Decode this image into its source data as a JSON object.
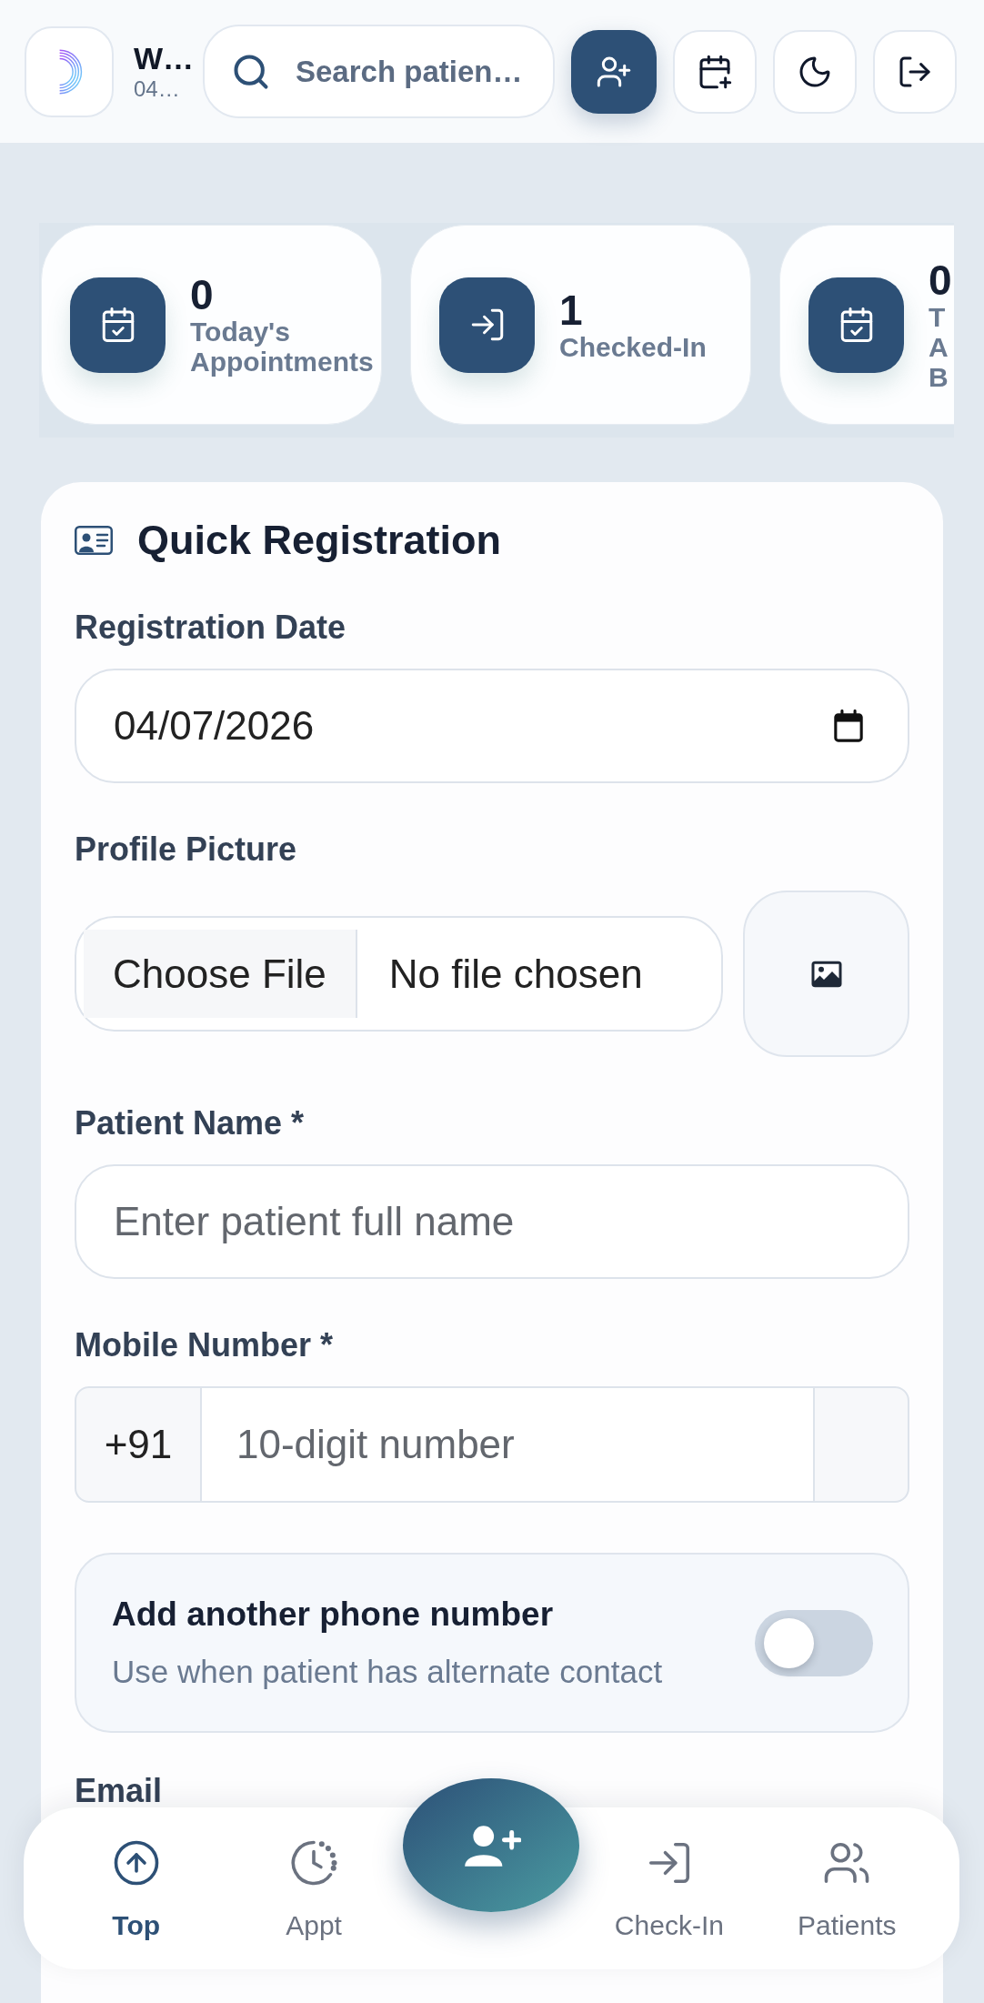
{
  "header": {
    "title": "W…",
    "subtitle": "04…",
    "search": {
      "placeholder": "Search patien…"
    }
  },
  "stats": [
    {
      "value": "0",
      "label": "Today's Appointments",
      "clipped": false
    },
    {
      "value": "1",
      "label": "Checked-In",
      "clipped": false
    },
    {
      "value": "0",
      "label": "T A B",
      "clipped": true
    }
  ],
  "form": {
    "title": "Quick Registration",
    "fields": [
      {
        "kind": "date",
        "label": "Registration Date",
        "value": "04/07/2026"
      },
      {
        "kind": "file",
        "label": "Profile Picture",
        "button": "Choose File",
        "value": "No file chosen"
      },
      {
        "kind": "text",
        "label": "Patient Name *",
        "placeholder": "Enter patient full name"
      },
      {
        "kind": "phone",
        "label": "Mobile Number *",
        "prefix": "+91",
        "placeholder": "10-digit number"
      },
      {
        "kind": "toggle",
        "label": "Add another phone number",
        "hint": "Use when patient has alternate contact",
        "on": false
      },
      {
        "kind": "label",
        "label": "Email"
      }
    ]
  },
  "bottom_nav": {
    "items": [
      {
        "label": "Top",
        "selected": true
      },
      {
        "label": "Appt",
        "selected": false
      },
      {
        "label": "Check-In",
        "selected": false
      },
      {
        "label": "Patients",
        "selected": false
      }
    ]
  }
}
